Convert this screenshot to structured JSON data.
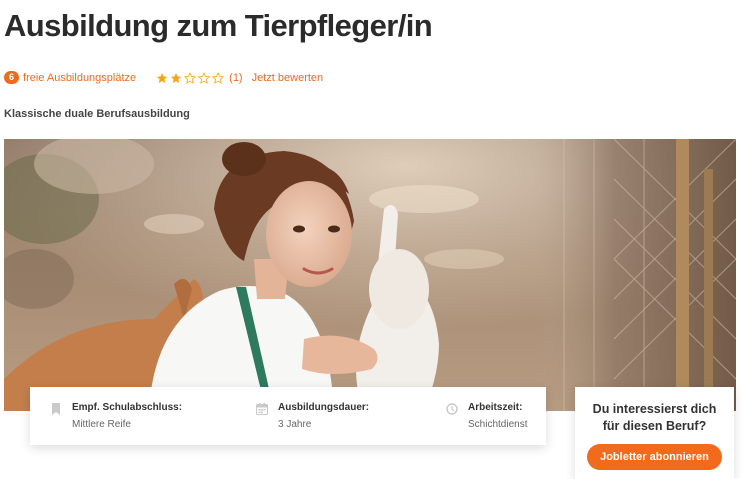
{
  "page": {
    "title": "Ausbildung zum Tierpfleger/in",
    "subtitle": "Klassische duale Berufsausbildung"
  },
  "meta": {
    "free_count": "6",
    "free_label": "freie Ausbildungsplätze",
    "rating_value": 2,
    "rating_max": 5,
    "rating_count": "(1)",
    "rate_link": "Jetzt bewerten"
  },
  "info": [
    {
      "icon": "bookmark-icon",
      "label": "Empf. Schulabschluss:",
      "value": "Mittlere Reife"
    },
    {
      "icon": "calendar-icon",
      "label": "Ausbildungsdauer:",
      "value": "3 Jahre"
    },
    {
      "icon": "clock-icon",
      "label": "Arbeitszeit:",
      "value": "Schichtdienst"
    }
  ],
  "subscribe": {
    "line1": "Du interessierst dich",
    "line2": "für diesen Beruf?",
    "button": "Jobletter abonnieren"
  },
  "colors": {
    "accent": "#ee6a1f",
    "star": "#f3a712",
    "title": "#2b2b2b"
  }
}
